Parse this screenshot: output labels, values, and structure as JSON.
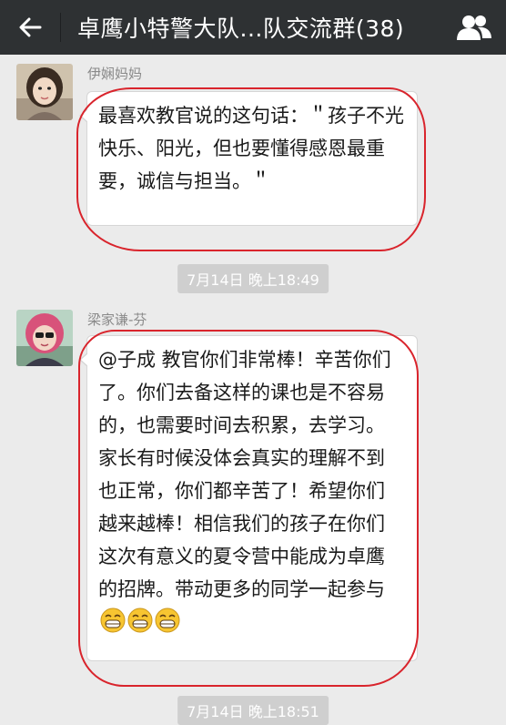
{
  "header": {
    "title": "卓鹰小特警大队...队交流群(38)"
  },
  "messages": [
    {
      "sender": "伊娴妈妈",
      "text": "最喜欢教官说的这句话：＂孩子不光快乐、阳光，但也要懂得感恩最重要，诚信与担当。＂"
    },
    {
      "sender": "梁家谦-芬",
      "text": "@子成 教官你们非常棒！辛苦你们了。你们去备这样的课也是不容易的，也需要时间去积累，去学习。家长有时候没体会真实的理解不到也正常，你们都辛苦了！希望你们越来越棒！相信我们的孩子在你们这次有意义的夏令营中能成为卓鹰的招牌。带动更多的同学一起参与"
    }
  ],
  "timestamps": [
    "7月14日 晚上18:49",
    "7月14日 晚上18:51"
  ],
  "colors": {
    "topbar": "#2e3133",
    "annotation": "#d9242c"
  }
}
